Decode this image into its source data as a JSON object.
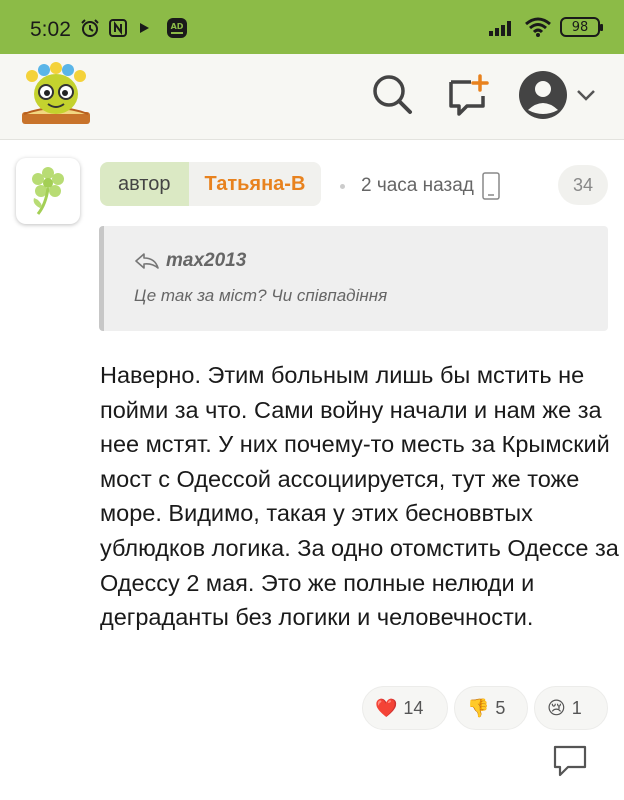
{
  "status_bar": {
    "time": "5:02",
    "battery": "98",
    "icons": [
      "alarm-icon",
      "nfc-icon",
      "play-icon",
      "ad-badge-icon",
      "signal-icon",
      "wifi-icon",
      "battery-icon"
    ]
  },
  "header": {
    "icons": [
      "search-icon",
      "new-post-icon",
      "user-avatar-icon",
      "chevron-down-icon"
    ]
  },
  "comment": {
    "author_role": "автор",
    "author_name": "Татьяна-В",
    "time_ago": "2 часа назад",
    "post_number": "34",
    "quote": {
      "author": "max2013",
      "text": "Це так за міст? Чи співпадіння"
    },
    "body": "Наверно. Этим больным лишь бы мстить не пойми за что. Сами войну начали и нам же за нее мстят. У них почему-то месть за Крымский мост с Одессой ассоциируется, тут же тоже море. Видимо, такая у этих бесноввтых ублюдков логика. За одно отомстить Одессе за Одессу 2 мая. Это же полные нелюди и деграданты без логики и человечности.",
    "reactions": [
      {
        "emoji": "❤️",
        "count": "14"
      },
      {
        "emoji": "👎",
        "count": "5"
      },
      {
        "emoji": "😢",
        "count": "1"
      }
    ]
  },
  "colors": {
    "status_bar": "#8cbb47",
    "author_name": "#e8821e",
    "author_role_bg": "#dbe9c4"
  }
}
